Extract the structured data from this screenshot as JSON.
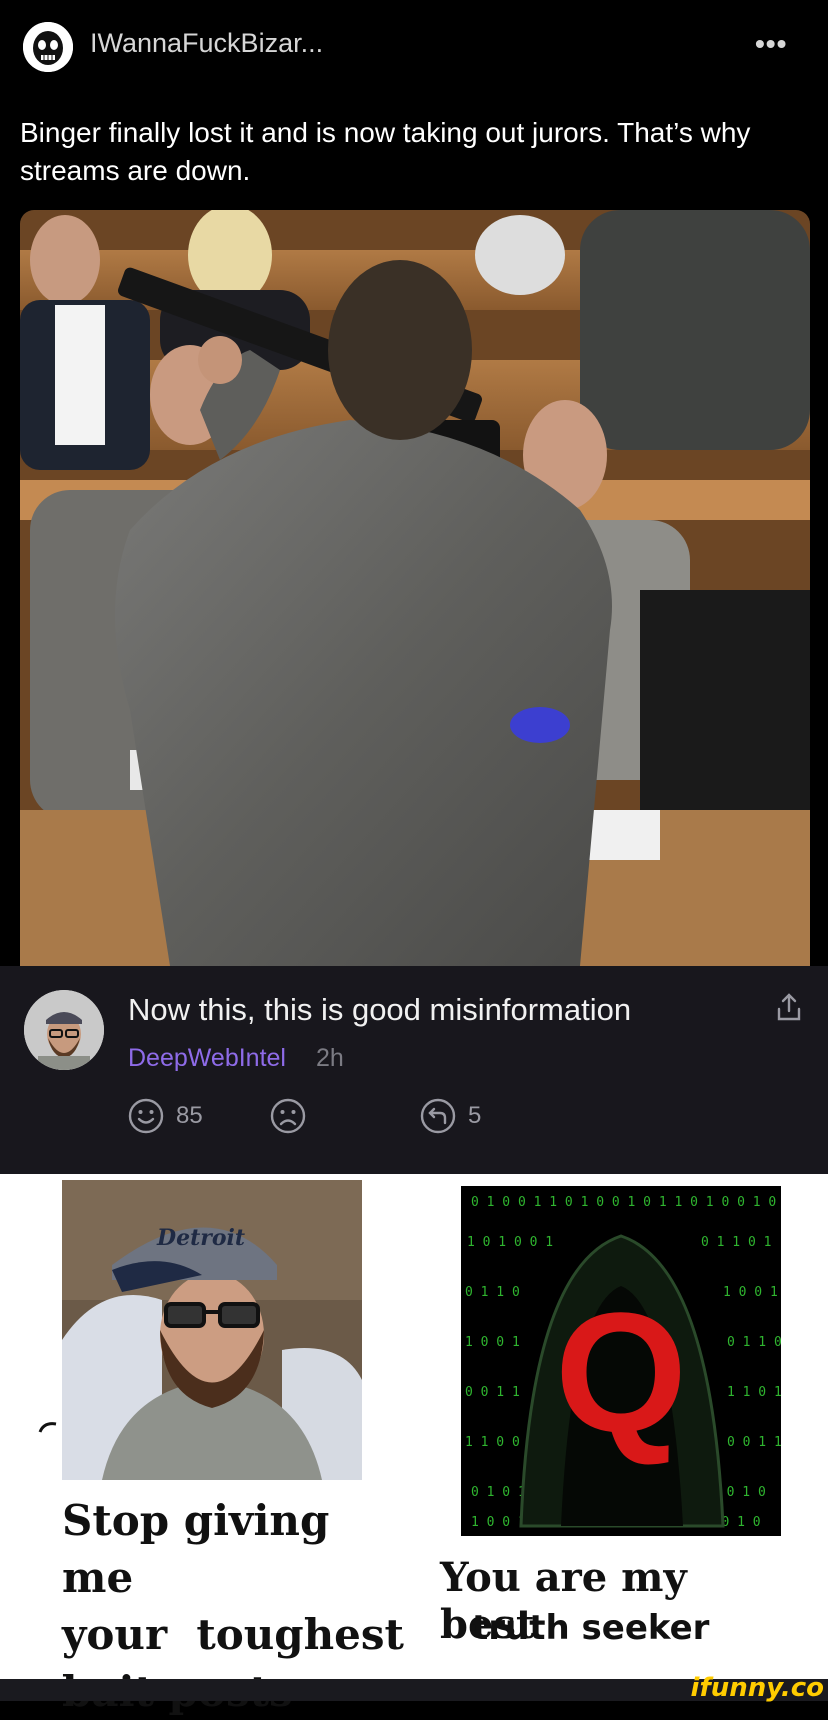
{
  "post": {
    "username": "IWannaFuckBizar...",
    "more_icon": "more-dots-icon",
    "caption": "Binger finally lost it and is now taking out jurors. That’s why streams are down."
  },
  "comment": {
    "text": "Now this, this is good misinformation",
    "author": "DeepWebIntel",
    "time": "2h",
    "likes": "85",
    "replies": "5",
    "icons": [
      "share-icon",
      "smile-icon",
      "frown-icon",
      "reply-icon"
    ]
  },
  "meme": {
    "left_caption": [
      "Stop giving me",
      "your  toughest",
      "bait posts"
    ],
    "right_caption_1": "You are my best",
    "right_caption_2": "truth seeker",
    "cap_text": "Detroit"
  },
  "footer": {
    "watermark": "ifunny.co"
  },
  "colors": {
    "background": "#000000",
    "comment_bg": "#18171d",
    "author": "#8e6be8",
    "watermark": "#ffcc00"
  }
}
